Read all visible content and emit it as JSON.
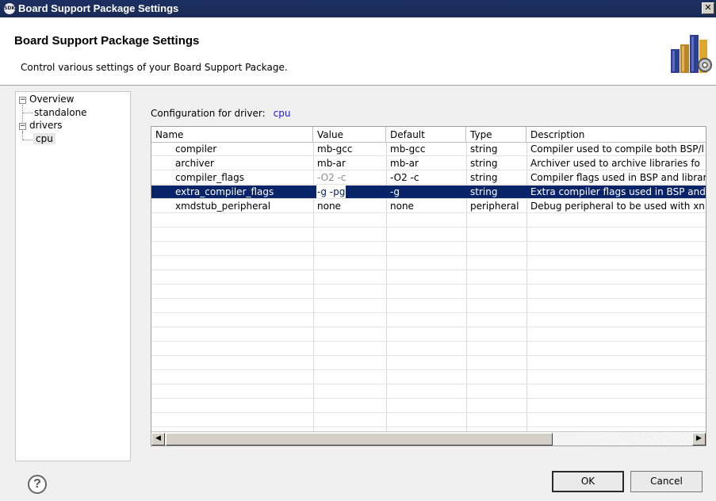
{
  "window": {
    "title": "Board Support Package Settings",
    "app_icon": "SDK"
  },
  "header": {
    "title": "Board Support Package Settings",
    "description": "Control various settings of your Board Support Package."
  },
  "tree": {
    "items": [
      {
        "label": "Overview",
        "expanded": true
      },
      {
        "label": "standalone"
      },
      {
        "label": "drivers",
        "expanded": true
      },
      {
        "label": "cpu",
        "selected": true
      }
    ]
  },
  "config": {
    "label": "Configuration for driver:",
    "driver": "cpu"
  },
  "table": {
    "columns": [
      "Name",
      "Value",
      "Default",
      "Type",
      "Description"
    ],
    "rows": [
      {
        "name": "compiler",
        "value": "mb-gcc",
        "default": "mb-gcc",
        "type": "string",
        "description": "Compiler used to compile both BSP/l"
      },
      {
        "name": "archiver",
        "value": "mb-ar",
        "default": "mb-ar",
        "type": "string",
        "description": "Archiver used to archive libraries fo"
      },
      {
        "name": "compiler_flags",
        "value": "-O2 -c",
        "default": "-O2 -c",
        "type": "string",
        "description": "Compiler flags used in BSP and librar"
      },
      {
        "name": "extra_compiler_flags",
        "value": "-g -pg",
        "default": "-g",
        "type": "string",
        "description": "Extra compiler flags used in BSP and"
      },
      {
        "name": "xmdstub_peripheral",
        "value": "none",
        "default": "none",
        "type": "peripheral",
        "description": "Debug peripheral to be used with xn"
      }
    ]
  },
  "buttons": {
    "help": "?",
    "ok": "OK",
    "cancel": "Cancel"
  },
  "colors": {
    "selection": "#0a246a",
    "link": "#1a1ad6",
    "titlebar": "#1b2f61"
  }
}
